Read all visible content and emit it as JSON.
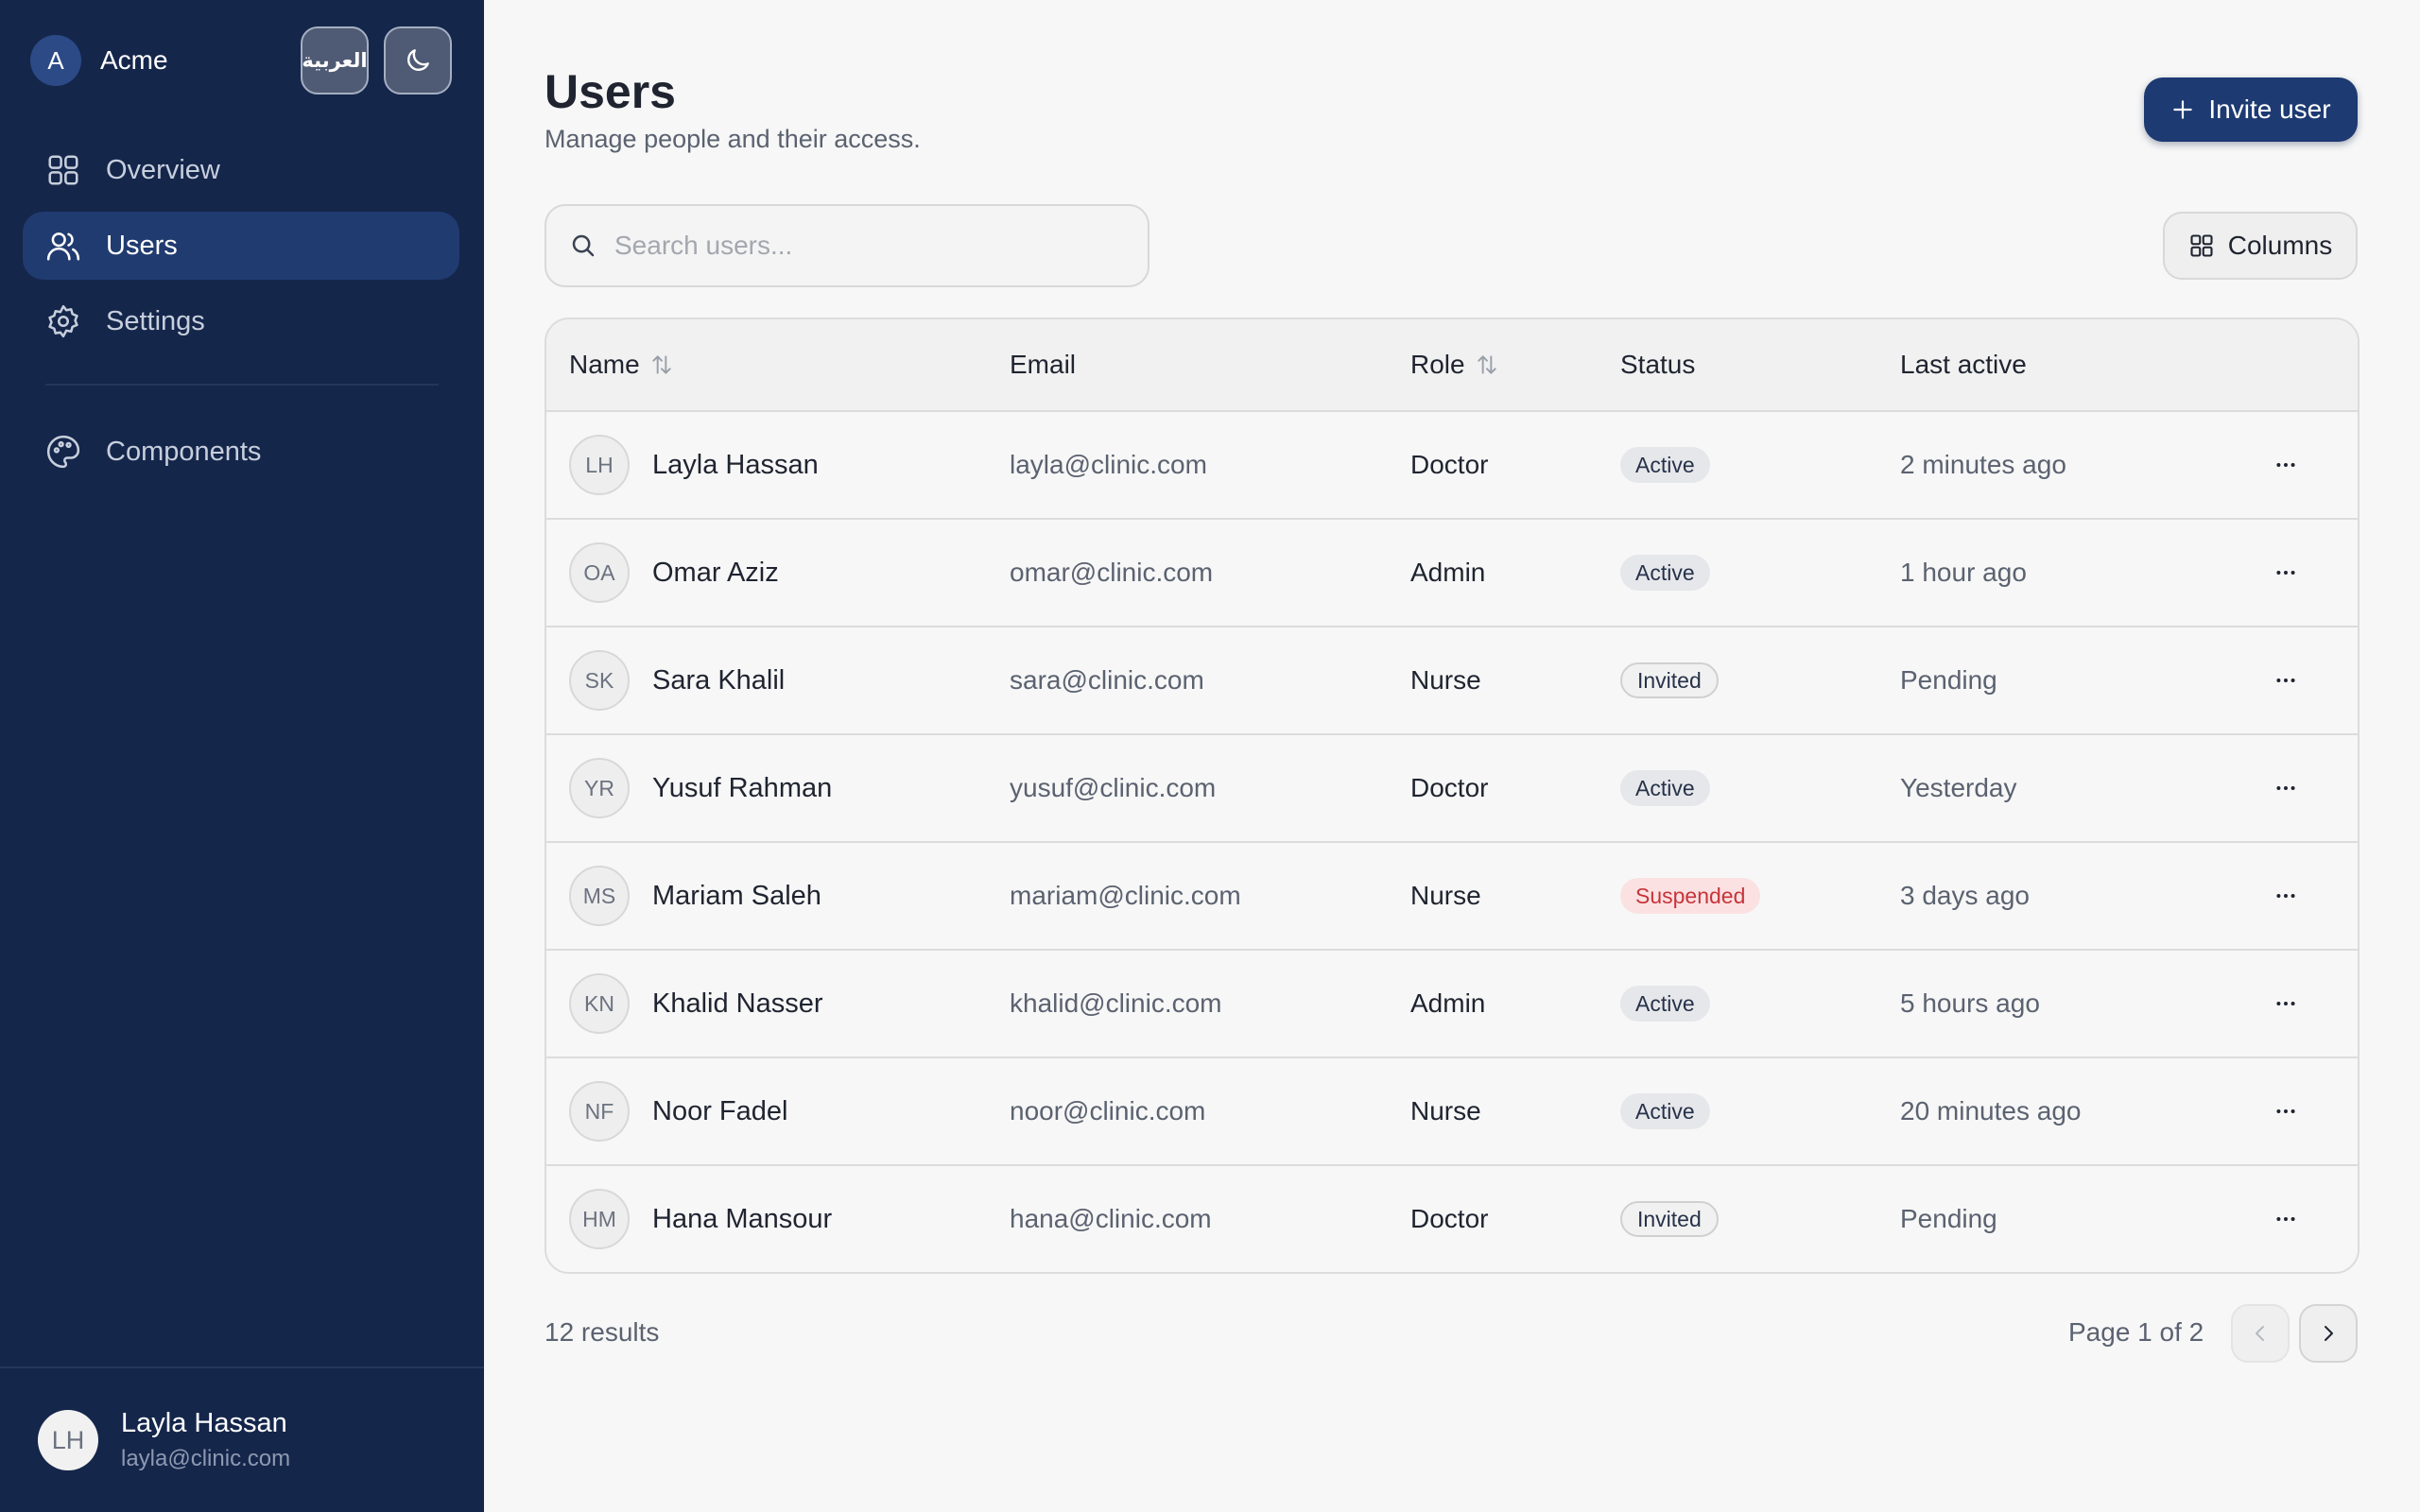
{
  "brand": {
    "avatar": "A",
    "name": "Acme",
    "language_label": "العربية",
    "theme_icon": "moon-icon"
  },
  "nav": {
    "items": [
      {
        "label": "Overview",
        "icon": "grid-icon"
      },
      {
        "label": "Users",
        "icon": "users-icon",
        "active": true
      },
      {
        "label": "Settings",
        "icon": "gear-icon"
      }
    ],
    "components": {
      "label": "Components",
      "icon": "palette-icon"
    }
  },
  "user": {
    "initials": "LH",
    "name": "Layla Hassan",
    "email": "layla@clinic.com"
  },
  "page": {
    "title": "Users",
    "subtitle": "Manage people and their access."
  },
  "toolbar": {
    "invite_label": "Invite user",
    "search_placeholder": "Search users...",
    "columns_label": "Columns"
  },
  "table": {
    "headers": {
      "name": "Name",
      "email": "Email",
      "role": "Role",
      "status": "Status",
      "last_active": "Last active"
    },
    "rows": [
      {
        "initials": "LH",
        "name": "Layla Hassan",
        "email": "layla@clinic.com",
        "role": "Doctor",
        "status": "Active",
        "last_active": "2 minutes ago"
      },
      {
        "initials": "OA",
        "name": "Omar Aziz",
        "email": "omar@clinic.com",
        "role": "Admin",
        "status": "Active",
        "last_active": "1 hour ago"
      },
      {
        "initials": "SK",
        "name": "Sara Khalil",
        "email": "sara@clinic.com",
        "role": "Nurse",
        "status": "Invited",
        "last_active": "Pending"
      },
      {
        "initials": "YR",
        "name": "Yusuf Rahman",
        "email": "yusuf@clinic.com",
        "role": "Doctor",
        "status": "Active",
        "last_active": "Yesterday"
      },
      {
        "initials": "MS",
        "name": "Mariam Saleh",
        "email": "mariam@clinic.com",
        "role": "Nurse",
        "status": "Suspended",
        "last_active": "3 days ago"
      },
      {
        "initials": "KN",
        "name": "Khalid Nasser",
        "email": "khalid@clinic.com",
        "role": "Admin",
        "status": "Active",
        "last_active": "5 hours ago"
      },
      {
        "initials": "NF",
        "name": "Noor Fadel",
        "email": "noor@clinic.com",
        "role": "Nurse",
        "status": "Active",
        "last_active": "20 minutes ago"
      },
      {
        "initials": "HM",
        "name": "Hana Mansour",
        "email": "hana@clinic.com",
        "role": "Doctor",
        "status": "Invited",
        "last_active": "Pending"
      }
    ]
  },
  "footer": {
    "results": "12 results",
    "page_info": "Page 1 of 2"
  },
  "colors": {
    "sidebar": "#15264b",
    "accent": "#1d3a72",
    "suspended": "#c7343b"
  }
}
